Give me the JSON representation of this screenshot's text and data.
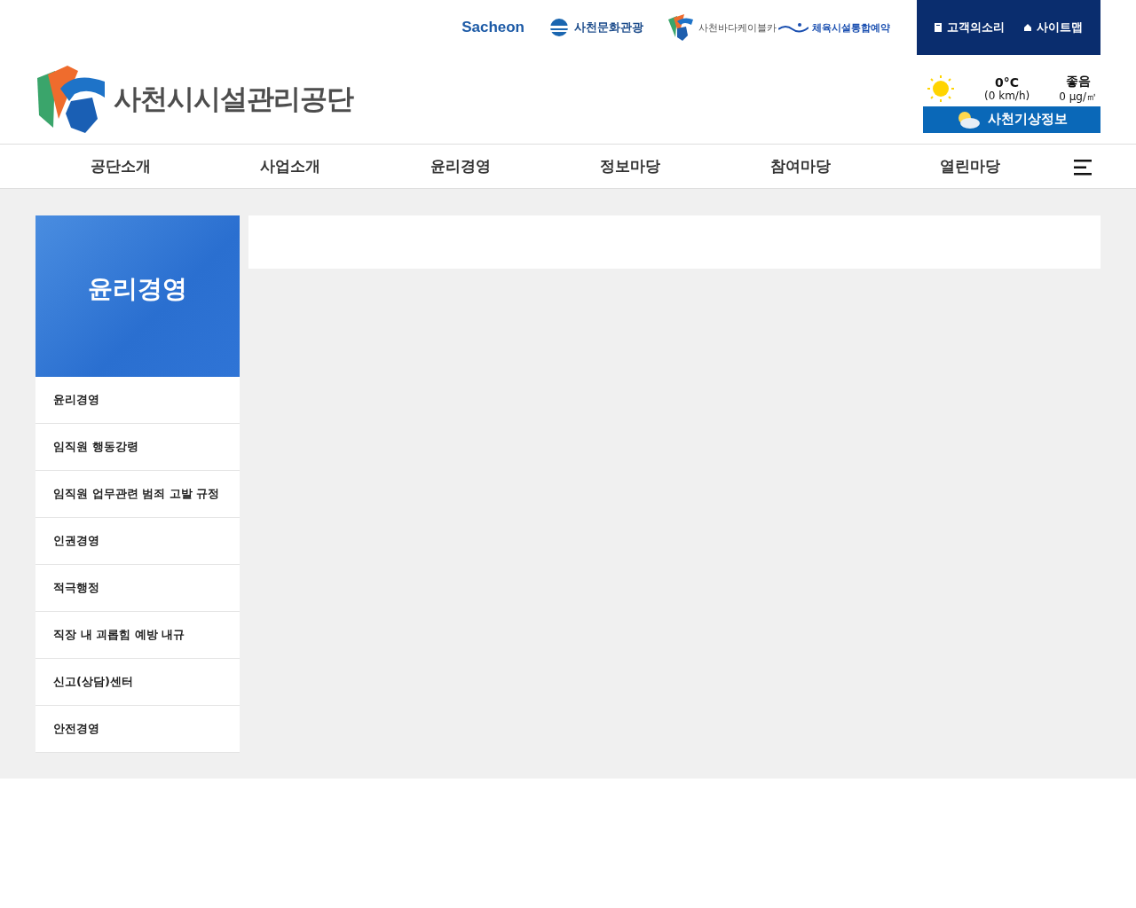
{
  "partner_links": [
    {
      "kind": "sacheon",
      "label": "Sacheon"
    },
    {
      "kind": "culture",
      "label": "사천문화관광"
    },
    {
      "kind": "cablecar",
      "label": "사천바다케이블카"
    },
    {
      "kind": "sports",
      "label": "체육시설통합예약"
    }
  ],
  "utility_links": [
    {
      "kind": "voice",
      "label": "고객의소리"
    },
    {
      "kind": "sitemap",
      "label": "사이트맵"
    }
  ],
  "logo": {
    "label": "사천시시설관리공단"
  },
  "weather": {
    "temperature": "0°C",
    "wind": "(0 km/h)",
    "air_quality": "좋음",
    "dust": "0 μg/㎥",
    "button": "사천기상정보"
  },
  "nav": [
    "공단소개",
    "사업소개",
    "윤리경영",
    "정보마당",
    "참여마당",
    "열린마당"
  ],
  "sidebar": {
    "title": "윤리경영",
    "items": [
      "윤리경영",
      "임직원 행동강령",
      "임직원 업무관련 범죄 고발 규정",
      "인권경영",
      "적극행정",
      "직장 내 괴롭힘 예방 내규",
      "신고(상담)센터",
      "안전경영"
    ]
  }
}
